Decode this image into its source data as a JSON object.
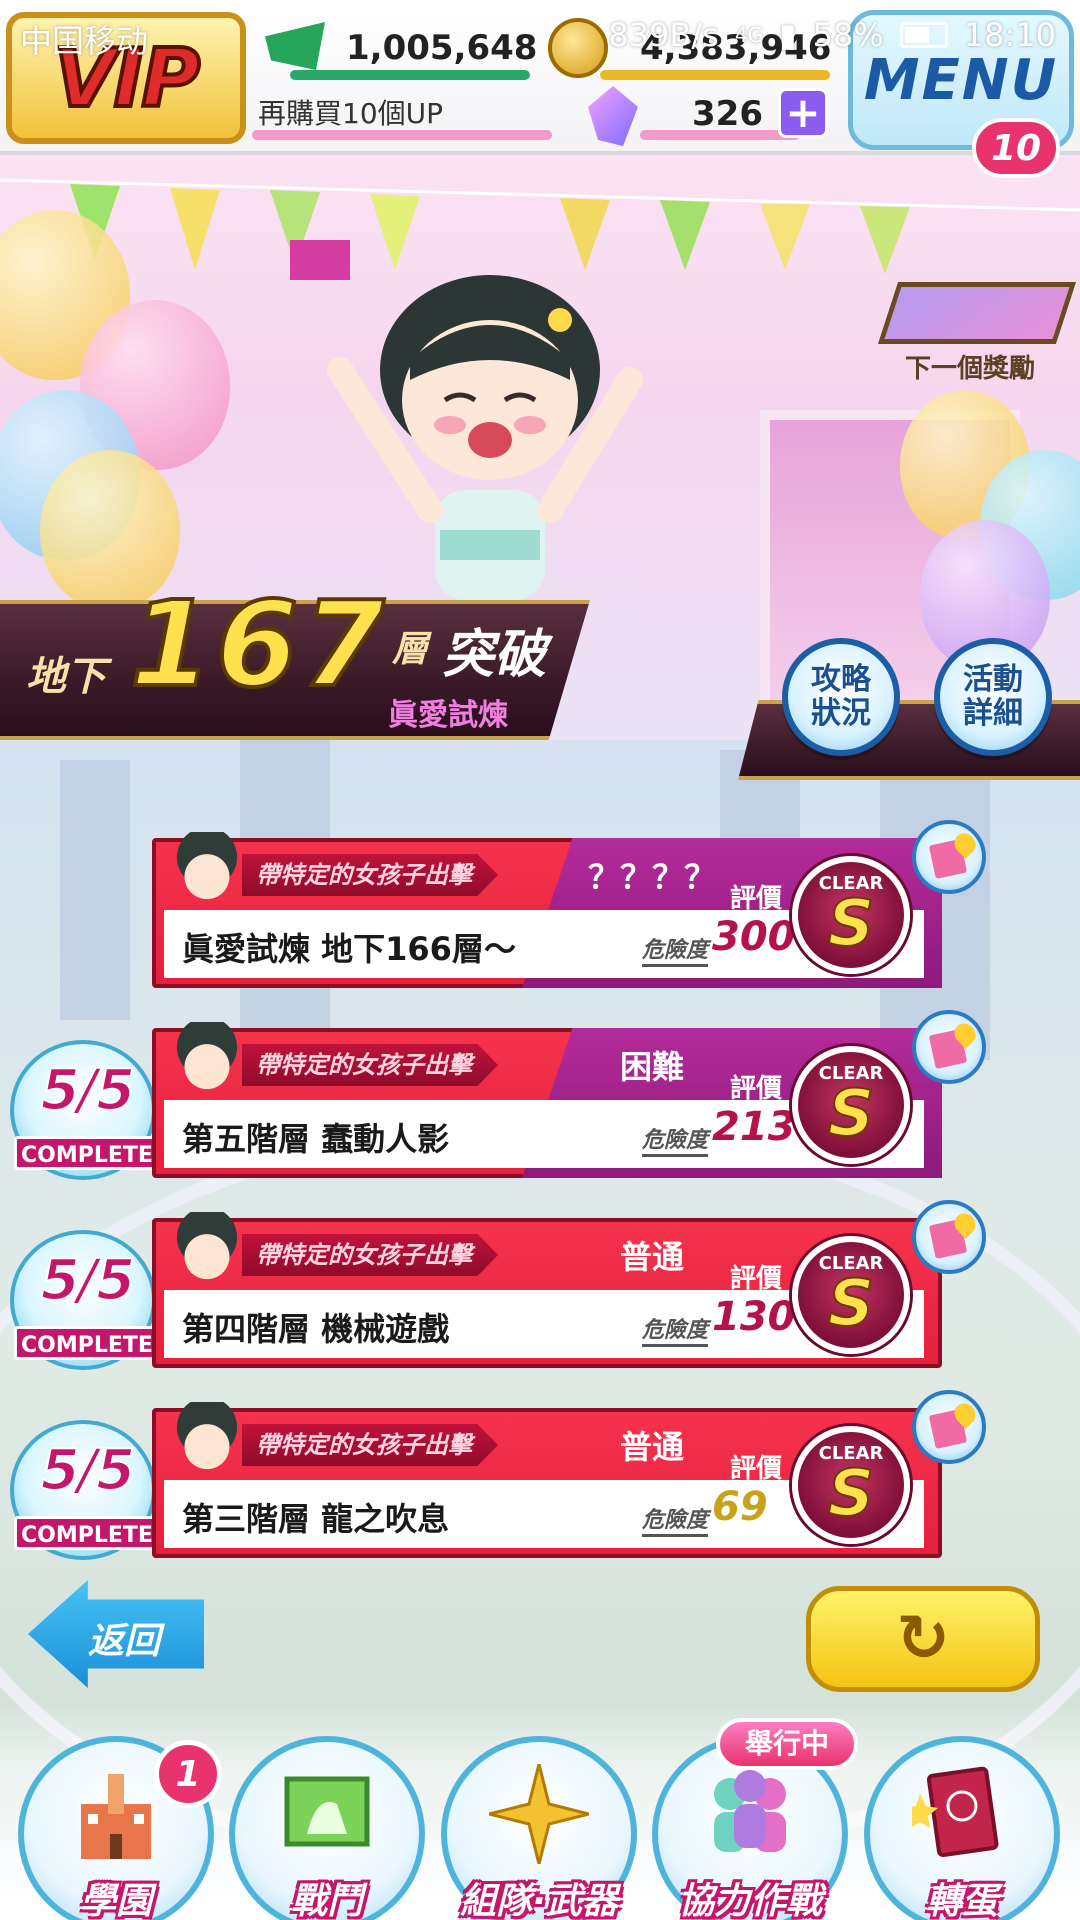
{
  "status_bar": {
    "carrier": "中国移动",
    "net_speed": "839B/s",
    "network": "4G",
    "battery": "58%",
    "time": "18:10"
  },
  "hud": {
    "vip_label": "VIP",
    "currency_green": "1,005,648",
    "currency_gold": "4,383,946",
    "promo_text": "再購買10個UP",
    "crystals": "326",
    "plus_label": "+",
    "menu_label": "MENU",
    "menu_badge": "10"
  },
  "next_reward_label": "下一個獎勵",
  "floor": {
    "prefix": "地下",
    "number": "167",
    "suffix": "層",
    "suffix2": "突破",
    "event_name": "眞愛試煉"
  },
  "side_buttons": {
    "status": "攻略\n狀況",
    "details": "活動\n詳細"
  },
  "stages": [
    {
      "tag": "帶特定的女孩子出擊",
      "difficulty": "？？？？",
      "eval_label": "評價",
      "title": "眞愛試煉 地下166層～",
      "risk_label": "危險度",
      "risk_value": "300",
      "clear_label": "CLEAR",
      "rank": "S",
      "complete": null
    },
    {
      "tag": "帶特定的女孩子出擊",
      "difficulty": "困難",
      "eval_label": "評價",
      "title": "第五階層 蠢動人影",
      "risk_label": "危險度",
      "risk_value": "213",
      "clear_label": "CLEAR",
      "rank": "S",
      "complete": {
        "fraction": "5/5",
        "label": "COMPLETE"
      }
    },
    {
      "tag": "帶特定的女孩子出擊",
      "difficulty": "普通",
      "eval_label": "評價",
      "title": "第四階層 機械遊戲",
      "risk_label": "危險度",
      "risk_value": "130",
      "clear_label": "CLEAR",
      "rank": "S",
      "complete": {
        "fraction": "5/5",
        "label": "COMPLETE"
      }
    },
    {
      "tag": "帶特定的女孩子出擊",
      "difficulty": "普通",
      "eval_label": "評價",
      "title": "第三階層 龍之吹息",
      "risk_label": "危險度",
      "risk_value": "69",
      "clear_label": "CLEAR",
      "rank": "S",
      "complete": {
        "fraction": "5/5",
        "label": "COMPLETE"
      }
    }
  ],
  "back_label": "返回",
  "refresh_icon": "↻",
  "nav": [
    {
      "label": "學園",
      "icon": "school-icon",
      "badge": "1"
    },
    {
      "label": "戰鬥",
      "icon": "battle-icon"
    },
    {
      "label": "組隊·武器",
      "icon": "team-weapon-icon"
    },
    {
      "label": "協力作戰",
      "icon": "coop-icon"
    },
    {
      "label": "轉蛋",
      "icon": "gacha-icon"
    }
  ],
  "active_event_tag": "舉行中",
  "colors": {
    "accent_red": "#e61f3d",
    "accent_purple": "#8c1a7b",
    "gold": "#ffe14d",
    "nav_pink": "#c4176b"
  }
}
